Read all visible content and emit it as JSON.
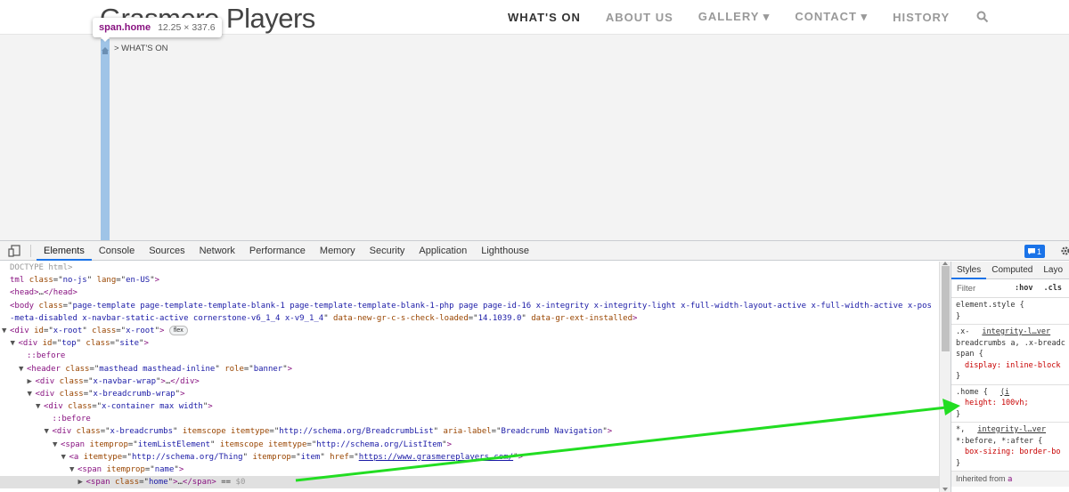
{
  "site": {
    "logo": "Grasmere Players",
    "nav": [
      {
        "label": "WHAT'S ON",
        "active": true
      },
      {
        "label": "ABOUT US",
        "active": false
      },
      {
        "label": "GALLERY ▾",
        "active": false
      },
      {
        "label": "CONTACT ▾",
        "active": false
      },
      {
        "label": "HISTORY",
        "active": false
      }
    ],
    "breadcrumb": "> WHAT'S ON",
    "tooltip": {
      "tag": "span.home",
      "dims": "12.25 × 337.6"
    }
  },
  "devtools": {
    "tabs": [
      "Elements",
      "Console",
      "Sources",
      "Network",
      "Performance",
      "Memory",
      "Security",
      "Application",
      "Lighthouse"
    ],
    "active_tab": "Elements",
    "badge_count": "1",
    "dom_lines": [
      {
        "indent": 0,
        "tri": "",
        "html": "<span class='cm'>DOCTYPE html></span>"
      },
      {
        "indent": 0,
        "tri": "",
        "html": "<span class='tg'>tml</span> <span class='an'>class</span>=\"<span class='av'>no-js</span>\" <span class='an'>lang</span>=\"<span class='av'>en-US</span>\"<span class='tg'>></span>"
      },
      {
        "indent": 0,
        "tri": "",
        "html": "<span class='tg'>&lt;head&gt;</span>…<span class='tg'>&lt;/head&gt;</span>"
      },
      {
        "indent": 0,
        "tri": "",
        "html": "<span class='tg'>&lt;body</span> <span class='an'>class</span>=\"<span class='av'>page-template page-template-template-blank-1 page-template-template-blank-1-php page page-id-16 x-integrity x-integrity-light x-full-width-layout-active x-full-width-active x-pos</span>"
      },
      {
        "indent": 0,
        "tri": "",
        "html": "<span class='av'>-meta-disabled x-navbar-static-active cornerstone-v6_1_4 x-v9_1_4</span>\" <span class='an'>data-new-gr-c-s-check-loaded</span>=\"<span class='av'>14.1039.0</span>\" <span class='an'>data-gr-ext-installed</span><span class='tg'>&gt;</span>"
      },
      {
        "indent": 0,
        "tri": "▼",
        "html": "<span class='tg'>&lt;div</span> <span class='an'>id</span>=\"<span class='av'>x-root</span>\" <span class='an'>class</span>=\"<span class='av'>x-root</span>\"<span class='tg'>&gt;</span> <span class='flexbadge'>flex</span>"
      },
      {
        "indent": 1,
        "tri": "▼",
        "html": "<span class='tg'>&lt;div</span> <span class='an'>id</span>=\"<span class='av'>top</span>\" <span class='an'>class</span>=\"<span class='av'>site</span>\"<span class='tg'>&gt;</span>"
      },
      {
        "indent": 2,
        "tri": "",
        "html": "<span class='tg'>::before</span>"
      },
      {
        "indent": 2,
        "tri": "▼",
        "html": "<span class='tg'>&lt;header</span> <span class='an'>class</span>=\"<span class='av'>masthead masthead-inline</span>\" <span class='an'>role</span>=\"<span class='av'>banner</span>\"<span class='tg'>&gt;</span>"
      },
      {
        "indent": 3,
        "tri": "▶",
        "html": "<span class='tg'>&lt;div</span> <span class='an'>class</span>=\"<span class='av'>x-navbar-wrap</span>\"<span class='tg'>&gt;</span>…<span class='tg'>&lt;/div&gt;</span>"
      },
      {
        "indent": 3,
        "tri": "▼",
        "html": "<span class='tg'>&lt;div</span> <span class='an'>class</span>=\"<span class='av'>x-breadcrumb-wrap</span>\"<span class='tg'>&gt;</span>"
      },
      {
        "indent": 4,
        "tri": "▼",
        "html": "<span class='tg'>&lt;div</span> <span class='an'>class</span>=\"<span class='av'>x-container max width</span>\"<span class='tg'>&gt;</span>"
      },
      {
        "indent": 5,
        "tri": "",
        "html": "<span class='tg'>::before</span>"
      },
      {
        "indent": 5,
        "tri": "▼",
        "html": "<span class='tg'>&lt;div</span> <span class='an'>class</span>=\"<span class='av'>x-breadcrumbs</span>\" <span class='an'>itemscope</span> <span class='an'>itemtype</span>=\"<span class='av'>http://schema.org/BreadcrumbList</span>\" <span class='an'>aria-label</span>=\"<span class='av'>Breadcrumb Navigation</span>\"<span class='tg'>&gt;</span>"
      },
      {
        "indent": 6,
        "tri": "▼",
        "html": "<span class='tg'>&lt;span</span> <span class='an'>itemprop</span>=\"<span class='av'>itemListElement</span>\" <span class='an'>itemscope</span> <span class='an'>itemtype</span>=\"<span class='av'>http://schema.org/ListItem</span>\"<span class='tg'>&gt;</span>"
      },
      {
        "indent": 7,
        "tri": "▼",
        "html": "<span class='tg'>&lt;a</span> <span class='an'>itemtype</span>=\"<span class='av'>http://schema.org/Thing</span>\" <span class='an'>itemprop</span>=\"<span class='av'>item</span>\" <span class='an'>href</span>=\"<span class='lk'>https://www.grasmereplayers.com/</span>\"<span class='tg'>&gt;</span>"
      },
      {
        "indent": 8,
        "tri": "▼",
        "html": "<span class='tg'>&lt;span</span> <span class='an'>itemprop</span>=\"<span class='av'>name</span>\"<span class='tg'>&gt;</span>"
      },
      {
        "indent": 9,
        "tri": "▶",
        "html": "<span class='tg'>&lt;span</span> <span class='an'>class</span>=\"<span class='av'>home</span>\"<span class='tg'>&gt;</span>…<span class='tg'>&lt;/span&gt;</span> == <span class='cm'>$0</span>",
        "selected": true
      }
    ],
    "styles_tabs": [
      "Styles",
      "Computed",
      "Layo"
    ],
    "filter_placeholder": "Filter",
    "filter_hov": ":hov",
    "filter_cls": ".cls",
    "rules": [
      {
        "lines": [
          "element.style {",
          "}"
        ]
      },
      {
        "lines": [
          ".x-",
          "breadcrumbs a, .x-breadc",
          "span {",
          "display: inline-block",
          "}"
        ],
        "src": "integrity-l…ver",
        "prop_idx": [
          3
        ]
      },
      {
        "lines": [
          ".home {",
          "height: 100vh;",
          "}"
        ],
        "src": "(i",
        "prop_idx": [
          1
        ]
      },
      {
        "lines": [
          "*,",
          "*:before, *:after {",
          "box-sizing: border-bo",
          "}"
        ],
        "src": "integrity-l…ver",
        "prop_idx": [
          2
        ]
      }
    ],
    "inherited_label": "Inherited from",
    "inherited_tag": "a"
  },
  "colors": {
    "arrow": "#22dd22",
    "selection": "#9fc4e7",
    "accent": "#1a73e8"
  }
}
